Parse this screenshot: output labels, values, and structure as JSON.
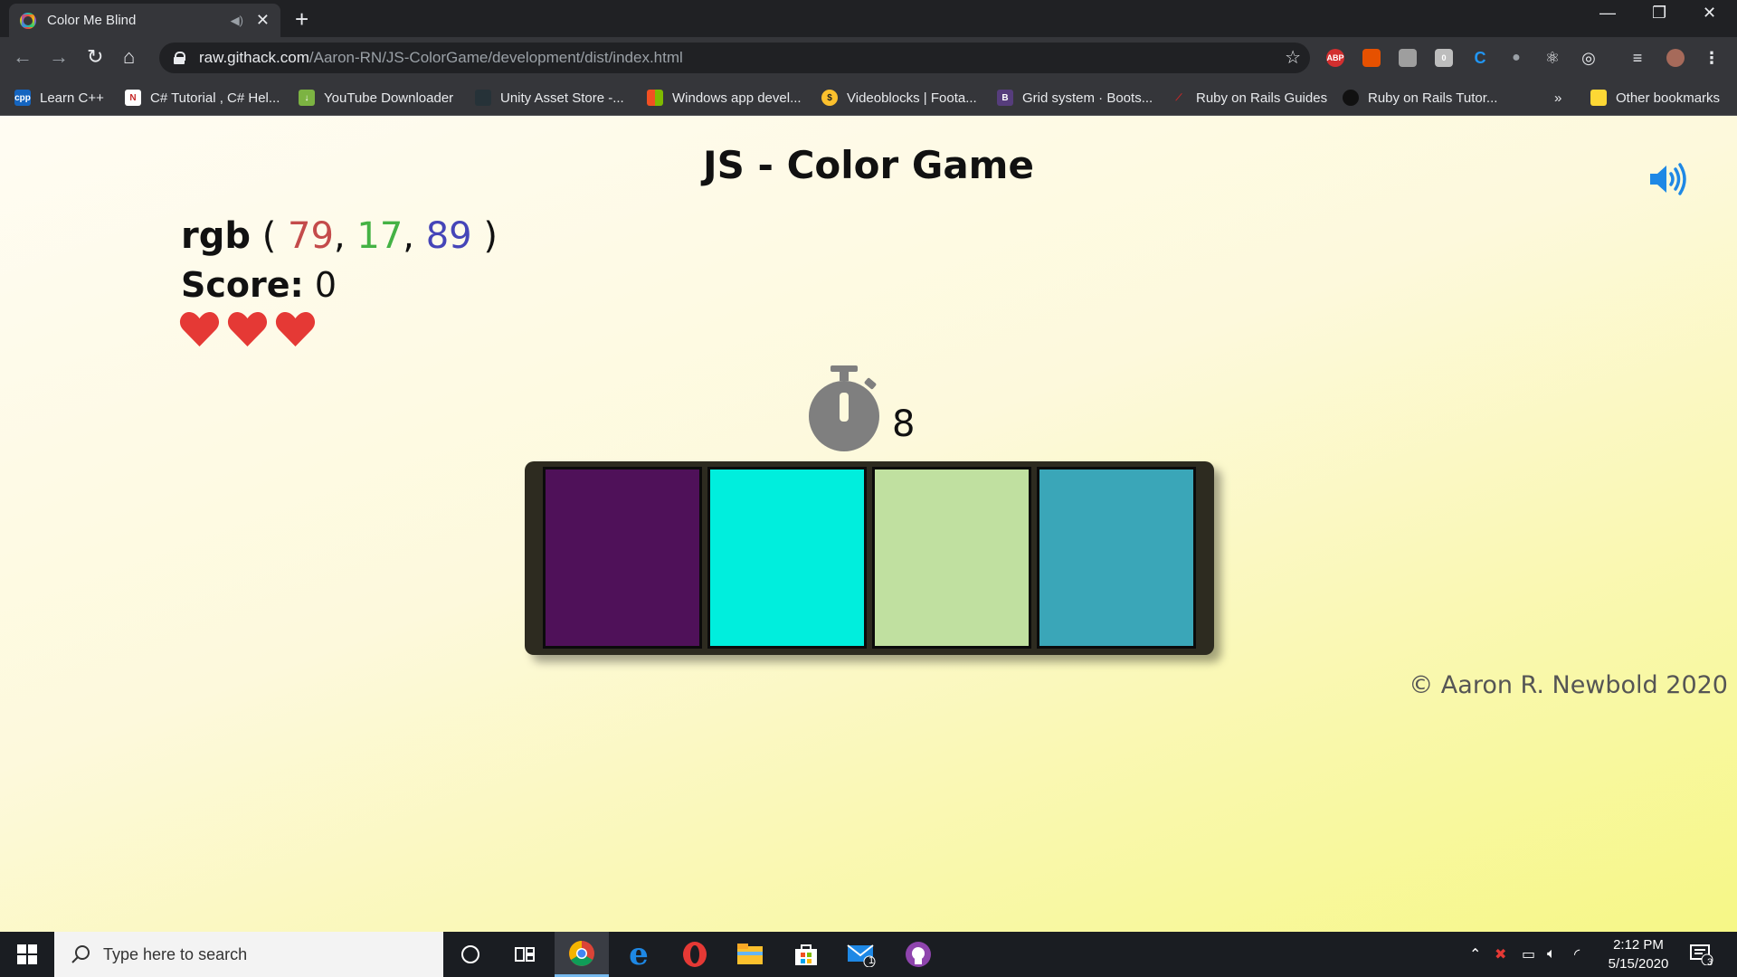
{
  "browser": {
    "tab_title": "Color Me Blind",
    "url_host": "raw.githack.com",
    "url_path": "/Aaron-RN/JS-ColorGame/development/dist/index.html",
    "bookmarks": [
      "Learn C++",
      "C# Tutorial , C# Hel...",
      "YouTube Downloader",
      "Unity Asset Store -...",
      "Windows app devel...",
      "Videoblocks | Foota...",
      "Grid system · Boots...",
      "Ruby on Rails Guides",
      "Ruby on Rails Tutor..."
    ],
    "bookmarks_overflow": "»",
    "other_bookmarks": "Other bookmarks",
    "extension_badges": {
      "abp": "ABP",
      "counter": "0"
    }
  },
  "game": {
    "title": "JS - Color Game",
    "rgb_label": "rgb",
    "open_paren": "(",
    "close_paren": ")",
    "comma": ",",
    "r": "79",
    "g": "17",
    "b": "89",
    "score_label": "Score:",
    "score": "0",
    "lives": 3,
    "timer": "8",
    "swatches": [
      "#4f1159",
      "#00eedd",
      "#c0e0a0",
      "#3aa6b8"
    ],
    "credit": "© Aaron R. Newbold 2020",
    "colors": {
      "red": "#c44b4b",
      "green": "#44b244",
      "blue": "#4545b8",
      "heart": "#e53935",
      "sound": "#1e88e5"
    }
  },
  "taskbar": {
    "search_placeholder": "Type here to search",
    "time": "2:12 PM",
    "date": "5/15/2020",
    "mail_badge": "1",
    "notification_badge": "3"
  }
}
